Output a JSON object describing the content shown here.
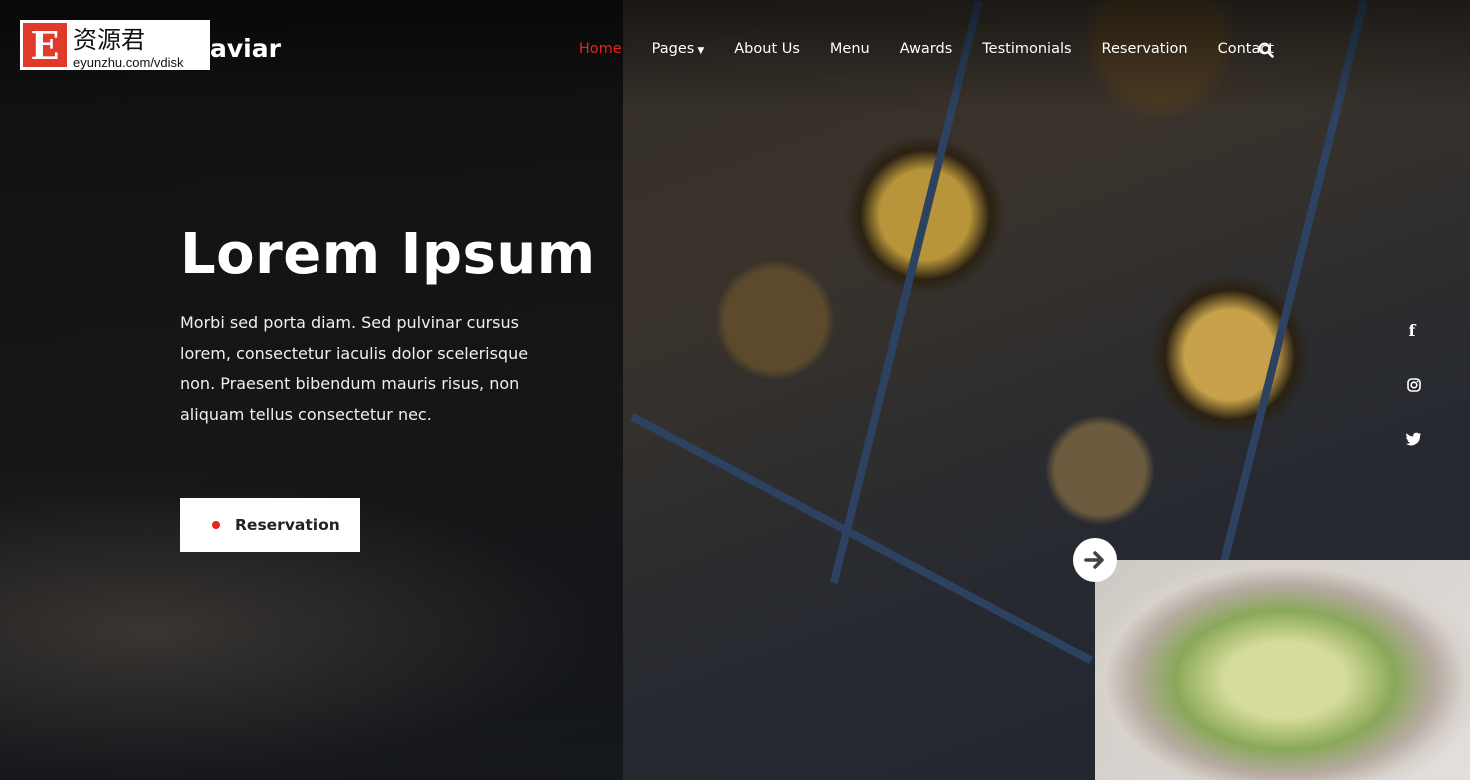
{
  "watermark": {
    "logo_letter": "E",
    "chinese": "资源君",
    "url": "eyunzhu.com/vdisk"
  },
  "brand": "aviar",
  "nav": {
    "items": [
      {
        "label": "Home",
        "active": true
      },
      {
        "label": "Pages"
      },
      {
        "label": "About Us"
      },
      {
        "label": "Menu"
      },
      {
        "label": "Awards"
      },
      {
        "label": "Testimonials"
      },
      {
        "label": "Reservation"
      },
      {
        "label": "Contact"
      }
    ],
    "search_icon": "search-icon"
  },
  "hero": {
    "title": "Lorem Ipsum",
    "description": "Morbi sed porta diam. Sed pulvinar cursus lorem, consectetur iaculis dolor scelerisque non. Praesent bibendum mauris risus, non aliquam tellus consectetur nec.",
    "button_label": "Reservation"
  },
  "social": [
    "facebook-icon",
    "instagram-icon",
    "twitter-icon"
  ],
  "colors": {
    "accent": "#e8221e"
  }
}
